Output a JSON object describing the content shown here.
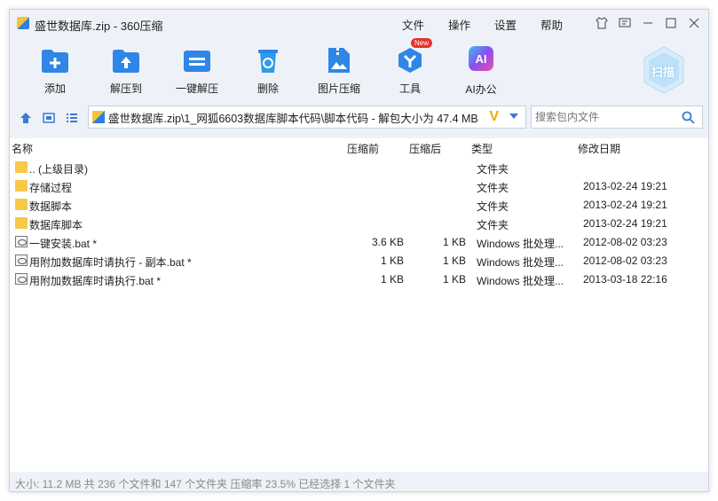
{
  "window": {
    "title": "盛世数据库.zip - 360压缩"
  },
  "menu": [
    "文件",
    "操作",
    "设置",
    "帮助"
  ],
  "toolbar": {
    "add": "添加",
    "extract_to": "解压到",
    "one_click_extract": "一键解压",
    "delete": "删除",
    "image_compress": "图片压缩",
    "tools": "工具",
    "tools_badge": "New",
    "ai_office": "AI办公",
    "ai_icon_text": "AI",
    "scan": "扫描"
  },
  "address": {
    "path": "盛世数据库.zip\\1_网狐6603数据库脚本代码\\脚本代码 - 解包大小为 47.4 MB",
    "search_placeholder": "搜索包内文件"
  },
  "columns": {
    "name": "名称",
    "before": "压缩前",
    "after": "压缩后",
    "type": "类型",
    "modified": "修改日期"
  },
  "files": [
    {
      "name": ".. (上级目录)",
      "size": "",
      "packed": "",
      "type": "文件夹",
      "date": "",
      "icon": "folder-icon"
    },
    {
      "name": "存储过程",
      "size": "",
      "packed": "",
      "type": "文件夹",
      "date": "2013-02-24 19:21",
      "icon": "folder-icon"
    },
    {
      "name": "数据脚本",
      "size": "",
      "packed": "",
      "type": "文件夹",
      "date": "2013-02-24 19:21",
      "icon": "folder-icon"
    },
    {
      "name": "数据库脚本",
      "size": "",
      "packed": "",
      "type": "文件夹",
      "date": "2013-02-24 19:21",
      "icon": "folder-icon"
    },
    {
      "name": "一键安装.bat *",
      "size": "3.6 KB",
      "packed": "1 KB",
      "type": "Windows 批处理...",
      "date": "2012-08-02 03:23",
      "icon": "batch-file-icon"
    },
    {
      "name": "用附加数据库时请执行 - 副本.bat *",
      "size": "1 KB",
      "packed": "1 KB",
      "type": "Windows 批处理...",
      "date": "2012-08-02 03:23",
      "icon": "batch-file-icon"
    },
    {
      "name": "用附加数据库时请执行.bat *",
      "size": "1 KB",
      "packed": "1 KB",
      "type": "Windows 批处理...",
      "date": "2013-03-18 22:16",
      "icon": "batch-file-icon"
    }
  ],
  "status": "大小: 11.2 MB 共 236 个文件和 147 个文件夹 压缩率 23.5% 已经选择 1 个文件夹",
  "colors": {
    "accent": "#2f7fe0",
    "window_bg": "#eef2f8",
    "folder": "#f7c948",
    "badge": "#e8312d"
  }
}
